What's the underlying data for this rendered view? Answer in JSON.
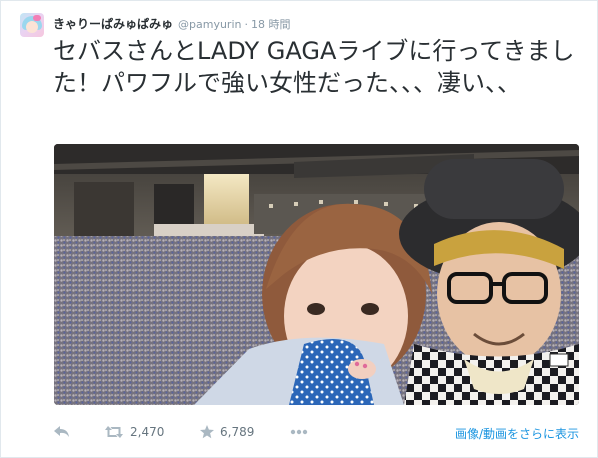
{
  "tweet": {
    "display_name": "きゃりーぱみゅぱみゅ",
    "handle": "@pamyurin",
    "separator": "·",
    "time": "18 時間",
    "text": "セバスさんとLADY GAGAライブに行ってきました！パワフルで強い女性だった、、、凄い、、"
  },
  "photo": {
    "description_icon": "concert-selfie-photo"
  },
  "actions": {
    "reply_icon": "reply-icon",
    "retweet_icon": "retweet-icon",
    "retweet_count": "2,470",
    "favorite_icon": "star-icon",
    "favorite_count": "6,789",
    "more_icon": "more-icon",
    "view_media_label": "画像/動画をさらに表示"
  },
  "colors": {
    "text": "#292f33",
    "meta": "#8899a6",
    "link": "#1b95e0",
    "border": "#e1e8ed"
  }
}
